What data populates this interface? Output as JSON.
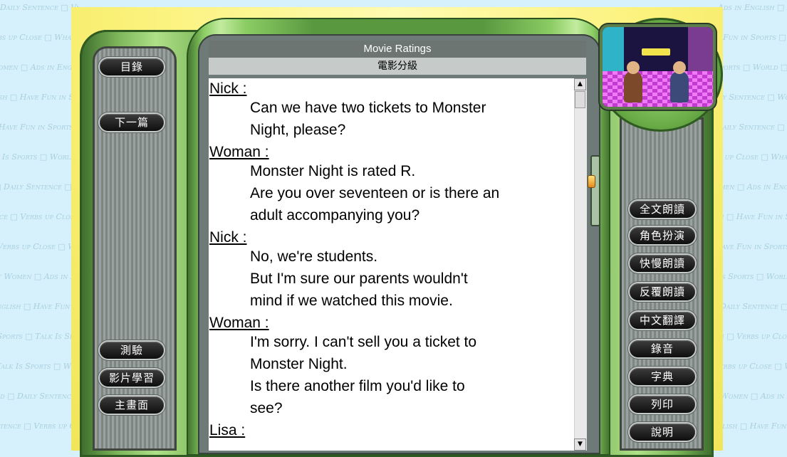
{
  "window": {
    "title": "Movie Ratings",
    "subtitle": "電影分級"
  },
  "left_buttons": {
    "contents": "目錄",
    "next": "下一篇",
    "quiz": "測驗",
    "video_study": "影片學習",
    "main_menu": "主畫面"
  },
  "right_buttons": {
    "read_all": "全文朗讀",
    "role_play": "角色扮演",
    "speed_read": "快慢朗讀",
    "repeat_read": "反覆朗讀",
    "translate": "中文翻譯",
    "record": "錄音",
    "dictionary": "字典",
    "print": "列印",
    "help": "說明"
  },
  "dialog": [
    {
      "speaker": "Nick :",
      "lines": [
        "Can we have two tickets to Monster",
        "Night, please?"
      ]
    },
    {
      "speaker": "Woman :",
      "lines": [
        "Monster Night is rated R.",
        "Are you over seventeen or is there an",
        "adult accompanying you?"
      ]
    },
    {
      "speaker": "Nick :",
      "lines": [
        "No, we're students.",
        "But I'm sure our parents wouldn't",
        "mind if we watched this movie."
      ]
    },
    {
      "speaker": "Woman :",
      "lines": [
        "I'm sorry. I can't sell you a ticket to",
        "Monster Night.",
        "Is there another film you'd like to",
        "see?"
      ]
    },
    {
      "speaker": "Lisa :",
      "lines": []
    }
  ],
  "background_phrases": [
    "Daily Sentence",
    "Verbs up Close",
    "What Women",
    "Ads in English",
    "Have Fun in Sports",
    "Talk Is Sports",
    "World"
  ],
  "theme": {
    "frame_green": "#5a9840",
    "button_black": "#1a1a1a",
    "header_gray": "#6c7572",
    "page_yellow": "#fbf27c"
  }
}
